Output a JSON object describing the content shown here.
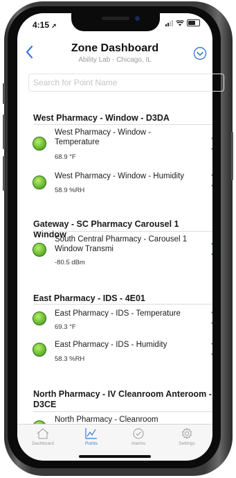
{
  "status": {
    "time": "4:15"
  },
  "header": {
    "title": "Zone Dashboard",
    "subtitle": "Ability Lab - Chicago, IL"
  },
  "search": {
    "placeholder": "Search for Point Name",
    "value": ""
  },
  "sections": [
    {
      "title": "West Pharmacy - Window - D3DA",
      "items": [
        {
          "name": "West Pharmacy - Window - Temperature",
          "value": "68.9 °F",
          "status": "ok"
        },
        {
          "name": "West Pharmacy - Window - Humidity",
          "value": "58.9 %RH",
          "status": "ok"
        }
      ]
    },
    {
      "title": "Gateway - SC Pharmacy Carousel 1 Window",
      "items": [
        {
          "name": "South Central Pharmacy - Carousel 1 Window Transmi",
          "value": "-80.5 dBm",
          "status": "ok"
        }
      ]
    },
    {
      "title": "East Pharmacy - IDS - 4E01",
      "items": [
        {
          "name": "East Pharmacy - IDS - Temperature",
          "value": "69.3 °F",
          "status": "ok"
        },
        {
          "name": "East Pharmacy - IDS - Humidity",
          "value": "58.3 %RH",
          "status": "ok"
        }
      ]
    },
    {
      "title": "North Pharmacy - IV Cleanroom Anteroom - D3CE",
      "items": [
        {
          "name": "North Pharmacy - Cleanroom",
          "value": "",
          "status": "ok"
        }
      ]
    }
  ],
  "tabs": [
    {
      "label": "Dashboard",
      "icon": "home-icon",
      "active": false
    },
    {
      "label": "Points",
      "icon": "chart-icon",
      "active": true
    },
    {
      "label": "Alarms",
      "icon": "alarm-check-icon",
      "active": false
    },
    {
      "label": "Settings",
      "icon": "gear-icon",
      "active": false
    }
  ],
  "colors": {
    "accent": "#3a7bd5",
    "status_ok": "#7cc63a"
  }
}
